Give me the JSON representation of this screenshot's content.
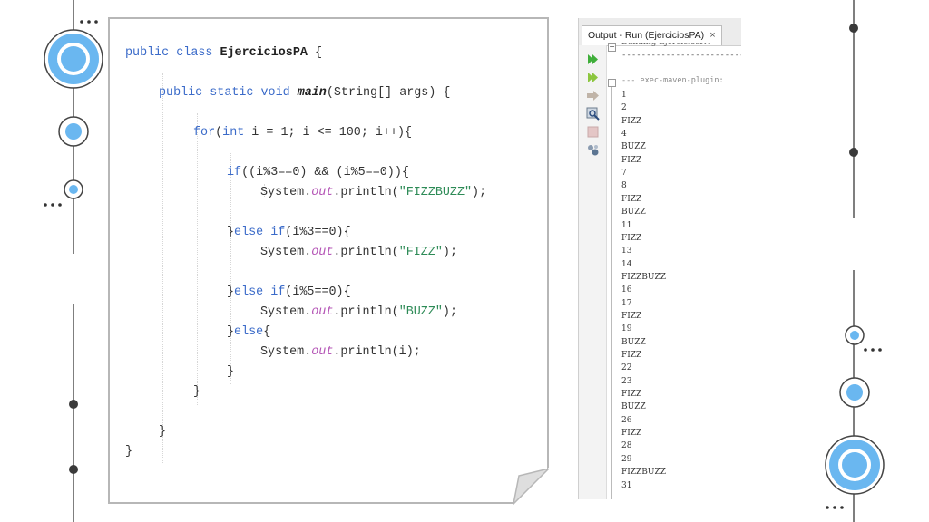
{
  "code": {
    "l1": {
      "kw": "public class ",
      "cls": "EjerciciosPA",
      "tail": " {"
    },
    "l2": {
      "kw": "public static void ",
      "m": "main",
      "tail": "(String[] args) {"
    },
    "l3": {
      "kw1": "for",
      "a": "(",
      "kw2": "int",
      "b": " i = 1; i <= 100; i++){"
    },
    "l4": {
      "kw": "if",
      "tail": "((i%3==0) && (i%5==0)){"
    },
    "l5": {
      "a": "System.",
      "f": "out",
      "b": ".println(",
      "s": "\"FIZZBUZZ\"",
      "c": ");"
    },
    "l6": {
      "a": "}",
      "kw": "else if",
      "b": "(i%3==0){"
    },
    "l7": {
      "a": "System.",
      "f": "out",
      "b": ".println(",
      "s": "\"FIZZ\"",
      "c": ");"
    },
    "l8": {
      "a": "}",
      "kw": "else if",
      "b": "(i%5==0){"
    },
    "l9": {
      "a": "System.",
      "f": "out",
      "b": ".println(",
      "s": "\"BUZZ\"",
      "c": ");"
    },
    "l10": {
      "a": "}",
      "kw": "else",
      "b": "{"
    },
    "l11": {
      "a": "System.",
      "f": "out",
      "b": ".println(i);"
    },
    "l12": "}",
    "l13": "}",
    "l14": "}",
    "l15": "}"
  },
  "output": {
    "tab_label": "Output - Run (EjerciciosPA)",
    "tab_close": "×",
    "header_partial": "Building EjerciciosPA",
    "separator": "------------------------------------",
    "plugin_line": "--- exec-maven-plugin:",
    "lines": [
      "1",
      "2",
      "FIZZ",
      "4",
      "BUZZ",
      "FIZZ",
      "7",
      "8",
      "FIZZ",
      "BUZZ",
      "11",
      "FIZZ",
      "13",
      "14",
      "FIZZBUZZ",
      "16",
      "17",
      "FIZZ",
      "19",
      "BUZZ",
      "FIZZ",
      "22",
      "23",
      "FIZZ",
      "BUZZ",
      "26",
      "FIZZ",
      "28",
      "29",
      "FIZZBUZZ",
      "31"
    ],
    "toolbar_icons": [
      "rerun-icon",
      "rerun-with-options-icon",
      "stop-arrow-icon",
      "settings-inspect-icon",
      "stop-icon",
      "output-settings-icon"
    ]
  },
  "colors": {
    "accent": "#6ab7f0",
    "accent_dark": "#3a3a3a",
    "keyword": "#3b6bc9",
    "string": "#2e8b57",
    "field": "#b455b6"
  }
}
